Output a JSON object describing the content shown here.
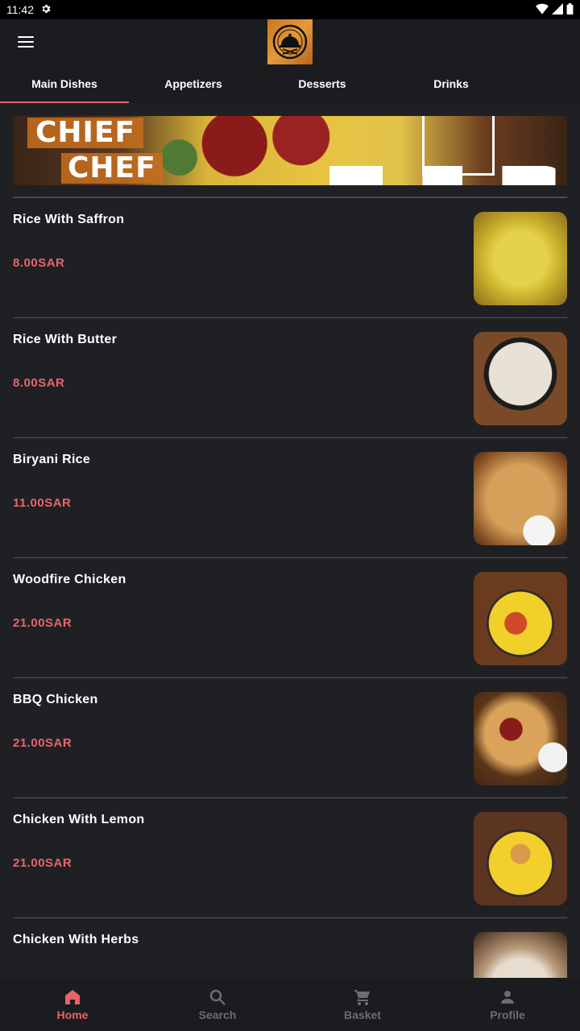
{
  "status_bar": {
    "time": "11:42"
  },
  "tabs": [
    {
      "label": "Main Dishes",
      "active": true
    },
    {
      "label": "Appetizers",
      "active": false
    },
    {
      "label": "Desserts",
      "active": false
    },
    {
      "label": "Drinks",
      "active": false
    }
  ],
  "banner": {
    "line1": "CHIEF",
    "line2": "CHEF"
  },
  "menu_items": [
    {
      "name": "Rice With Saffron",
      "price": "8.00SAR",
      "image": "saffron-rice-photo"
    },
    {
      "name": "Rice With Butter",
      "price": "8.00SAR",
      "image": "butter-rice-photo"
    },
    {
      "name": "Biryani Rice",
      "price": "11.00SAR",
      "image": "biryani-rice-photo"
    },
    {
      "name": "Woodfire Chicken",
      "price": "21.00SAR",
      "image": "woodfire-chicken-photo"
    },
    {
      "name": "BBQ Chicken",
      "price": "21.00SAR",
      "image": "bbq-chicken-photo"
    },
    {
      "name": "Chicken With Lemon",
      "price": "21.00SAR",
      "image": "lemon-chicken-photo"
    },
    {
      "name": "Chicken With Herbs",
      "price": "",
      "image": "herbs-chicken-photo"
    }
  ],
  "bottom_nav": [
    {
      "label": "Home",
      "icon": "home-icon",
      "active": true
    },
    {
      "label": "Search",
      "icon": "search-icon",
      "active": false
    },
    {
      "label": "Basket",
      "icon": "cart-icon",
      "active": false
    },
    {
      "label": "Profile",
      "icon": "person-icon",
      "active": false
    }
  ],
  "colors": {
    "background": "#1f2024",
    "accent": "#e8636a",
    "inactive": "#6c6d72"
  }
}
